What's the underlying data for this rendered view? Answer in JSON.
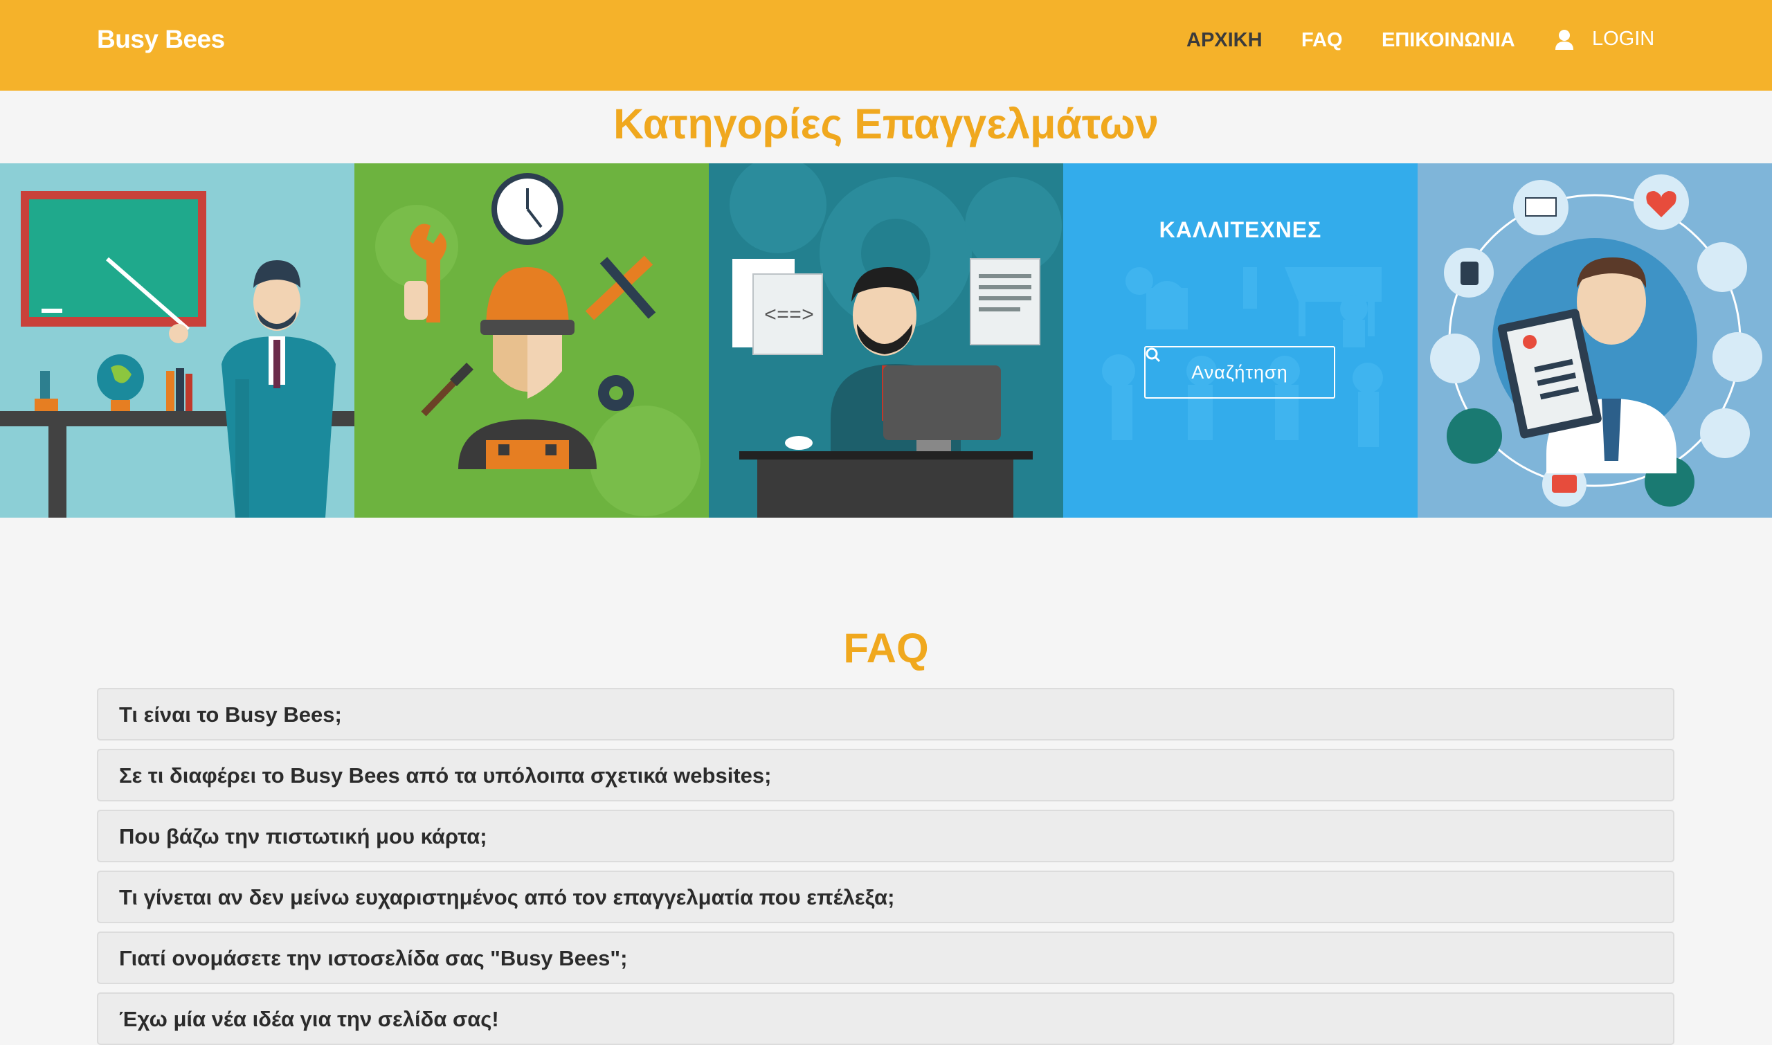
{
  "navbar": {
    "brand": "Busy Bees",
    "links": [
      "ΑΡΧΙΚΗ",
      "FAQ",
      "ΕΠΙΚΟΙΝΩΝΙΑ"
    ],
    "login": "LOGIN",
    "color": "#f5b22a"
  },
  "categories": {
    "title": "Κατηγορίες Επαγγελμάτων",
    "tiles": [
      {
        "icon": "teacher-illustration"
      },
      {
        "icon": "worker-illustration"
      },
      {
        "icon": "developer-illustration"
      },
      {
        "icon": "artists-illustration",
        "label": "ΚΑΛΛΙΤΕΧΝΕΣ",
        "search_label": "Αναζήτηση"
      },
      {
        "icon": "doctor-illustration"
      }
    ]
  },
  "faq": {
    "title": "FAQ",
    "items": [
      "Τι είναι το Busy Bees;",
      "Σε τι διαφέρει το Busy Bees από τα υπόλοιπα σχετικά websites;",
      "Που βάζω την πιστωτική μου κάρτα;",
      "Τι γίνεται αν δεν μείνω ευχαριστημένος από τον επαγγελματία που επέλεξα;",
      "Γιατί ονομάσετε την ιστοσελίδα σας \"Busy Bees\";",
      "Έχω μία νέα ιδέα για την σελίδα σας!"
    ]
  },
  "colors": {
    "accent": "#f0a81e",
    "teacher_bg": "#8ccfd6",
    "worker_bg": "#6db33f",
    "developer_bg": "#23808f",
    "artists_bg": "#33aceb",
    "doctor_bg": "#7fb5d9"
  }
}
